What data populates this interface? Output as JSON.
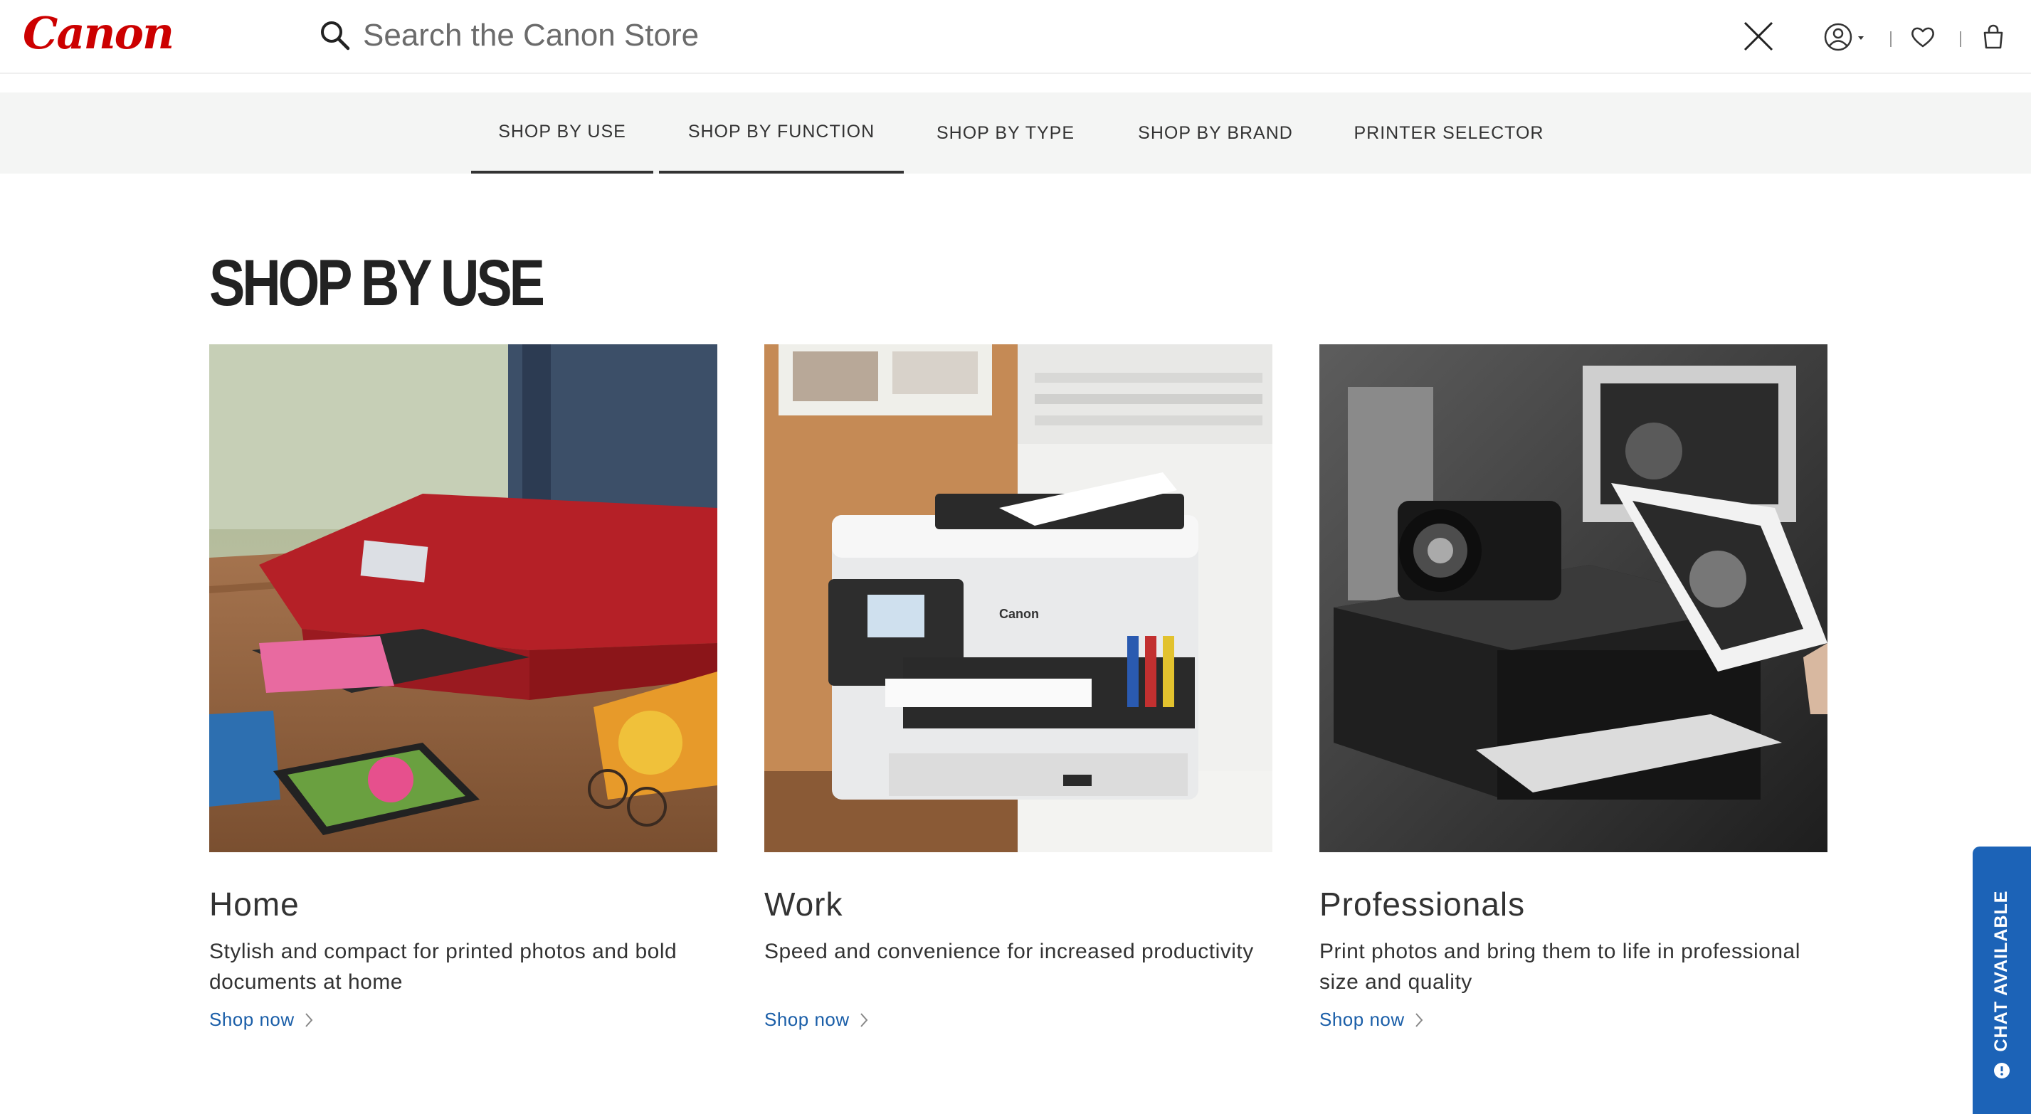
{
  "header": {
    "logo_text": "Canon",
    "search_placeholder": "Search the Canon Store",
    "icons": [
      "search-icon",
      "close-icon",
      "account-icon",
      "heart-icon",
      "bag-icon"
    ]
  },
  "category_nav": {
    "tabs": [
      {
        "label": "SHOP BY USE",
        "active": true
      },
      {
        "label": "SHOP BY FUNCTION",
        "active": true
      },
      {
        "label": "SHOP BY TYPE",
        "active": false
      },
      {
        "label": "SHOP BY BRAND",
        "active": false
      },
      {
        "label": "PRINTER SELECTOR",
        "active": false
      }
    ]
  },
  "main": {
    "title": "SHOP BY USE",
    "cards": [
      {
        "title": "Home",
        "description": "Stylish and compact for printed photos and bold documents at home",
        "link": "Shop now"
      },
      {
        "title": "Work",
        "description": "Speed and convenience for increased productivity",
        "link": "Shop now"
      },
      {
        "title": "Professionals",
        "description": "Print photos and bring them to life in professional size and quality",
        "link": "Shop now"
      }
    ]
  },
  "chat": {
    "label": "CHAT AVAILABLE"
  },
  "colors": {
    "brand": "#cc0000",
    "link": "#1a5ea8",
    "chat": "#1c63b7",
    "nav_bg": "#f4f5f4"
  }
}
